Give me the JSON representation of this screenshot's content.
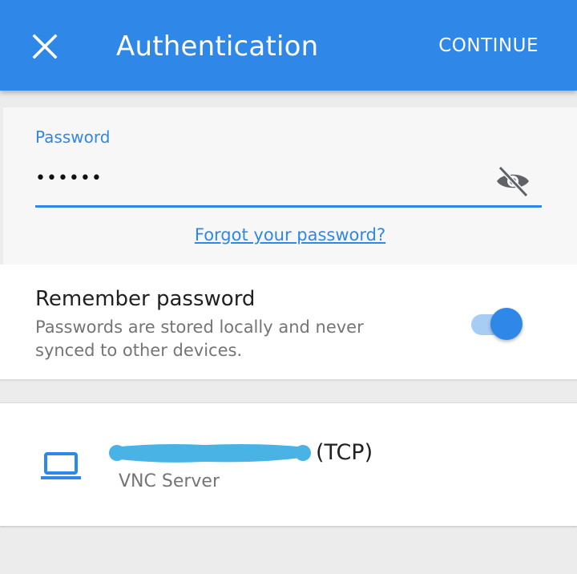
{
  "appbar": {
    "title": "Authentication",
    "continue_label": "CONTINUE",
    "close_icon": "close-icon",
    "color": "#2f87e8"
  },
  "password": {
    "label": "Password",
    "value": "••••••",
    "visibility_icon": "eye-off-icon",
    "forgot_link": "Forgot your password?"
  },
  "remember": {
    "title": "Remember password",
    "description": "Passwords are stored locally and never synced to other devices.",
    "enabled": true
  },
  "server": {
    "name_suffix": "(TCP)",
    "type": "VNC Server",
    "icon": "laptop-icon"
  }
}
